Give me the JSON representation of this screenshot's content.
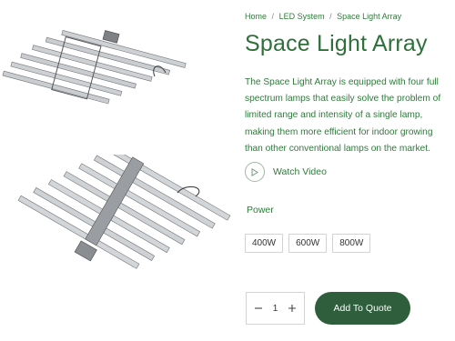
{
  "breadcrumb": {
    "items": [
      "Home",
      "LED System",
      "Space Light Array"
    ],
    "separator": "/"
  },
  "product": {
    "title": "Space Light Array",
    "description": "The Space Light Array is equipped with four full spectrum lamps that easily solve the problem of limited range and intensity of a single lamp, making them more efficient for indoor growing than other conventional lamps on the market.",
    "video_label": "Watch Video",
    "power_label": "Power",
    "power_options": [
      "400W",
      "600W",
      "800W"
    ],
    "quantity": "1",
    "add_label": "Add To Quote"
  },
  "colors": {
    "accent_text": "#2f7a3b",
    "button_bg": "#2e5e3c"
  },
  "icons": {
    "play": "play-icon",
    "minus": "minus-icon",
    "plus": "plus-icon"
  }
}
